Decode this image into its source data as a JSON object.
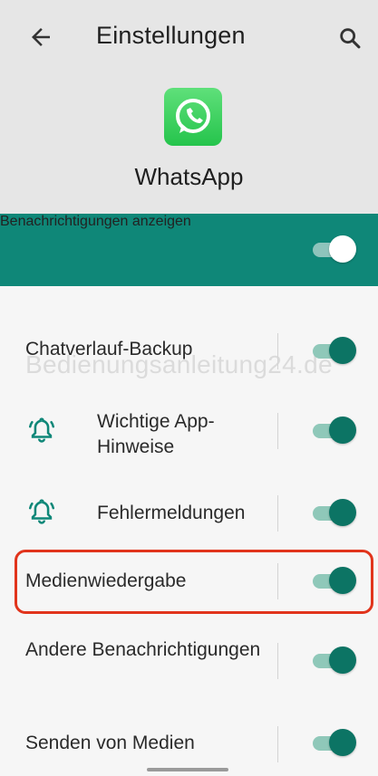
{
  "topbar": {
    "title": "Einstellungen",
    "back_icon": "arrow-left-icon",
    "search_icon": "search-icon"
  },
  "app": {
    "name": "WhatsApp",
    "icon": "whatsapp-logo-icon",
    "brand_color": "#25c44c"
  },
  "master_toggle": {
    "label": "Benachrichtigungen anzeigen",
    "on": true,
    "bar_color": "#0f8778"
  },
  "watermark": "Bedienungsanleitung24.de",
  "channels": [
    {
      "label": "Chatverlauf-Backup",
      "icon": null,
      "on": true
    },
    {
      "label": "Wichtige App-Hinweise",
      "icon": "bell-ringing-icon",
      "on": true
    },
    {
      "label": "Fehlermeldungen",
      "icon": "bell-ringing-icon",
      "on": true
    },
    {
      "label": "Medienwiedergabe",
      "icon": null,
      "on": true,
      "highlighted": true
    },
    {
      "label": "Andere Benachrichtigungen",
      "icon": null,
      "on": true
    },
    {
      "label": "Senden von Medien",
      "icon": null,
      "on": true
    }
  ],
  "colors": {
    "accent": "#0c7464",
    "highlight": "#e1341c"
  }
}
